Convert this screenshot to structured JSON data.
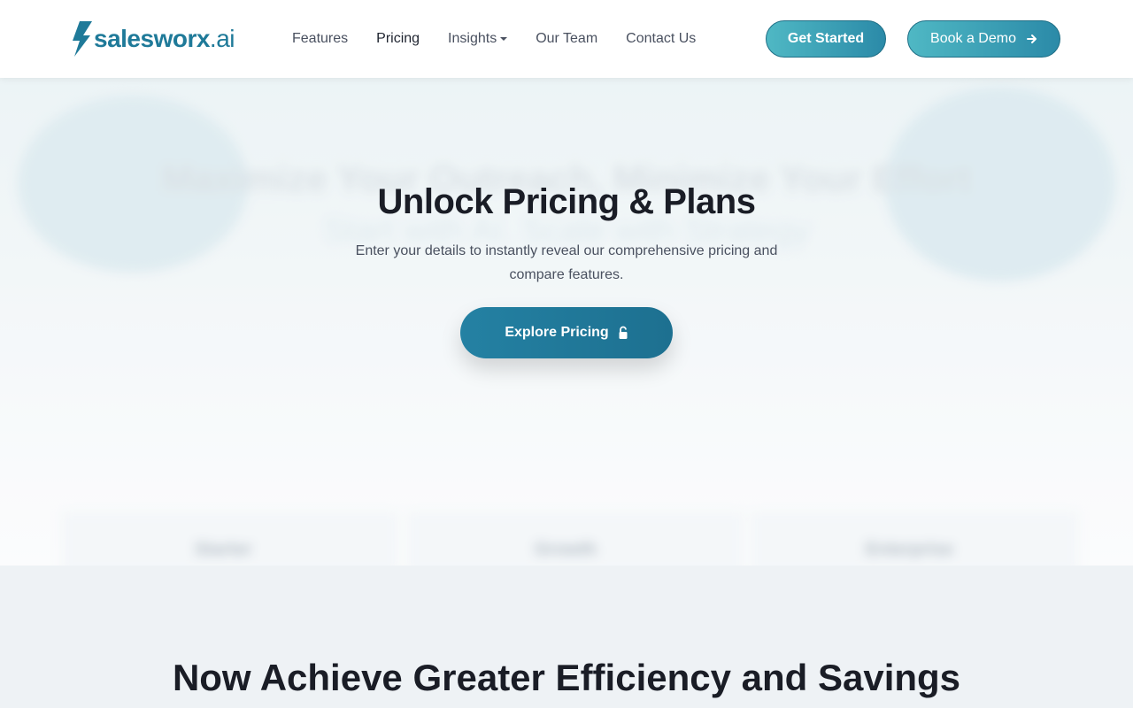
{
  "brand": {
    "name": "salesworx",
    "suffix": ".ai",
    "accent": "#1f7a99"
  },
  "nav": {
    "links": [
      {
        "label": "Features"
      },
      {
        "label": "Pricing"
      },
      {
        "label": "Insights"
      },
      {
        "label": "Our Team"
      },
      {
        "label": "Contact Us"
      }
    ],
    "get_started": "Get Started",
    "book_demo": "Book a Demo"
  },
  "hero_background": {
    "title": "Maximize Your Outreach, Minimize Your Effort",
    "subtitle": "Start with AI. Scale with Strategy",
    "cards": [
      "Starter",
      "Growth",
      "Enterprise"
    ]
  },
  "unlock": {
    "title": "Unlock Pricing & Plans",
    "description": "Enter your details to instantly reveal our comprehensive pricing and compare features.",
    "button_label": "Explore Pricing"
  },
  "section2": {
    "title": "Now Achieve Greater Efficiency and Savings"
  }
}
